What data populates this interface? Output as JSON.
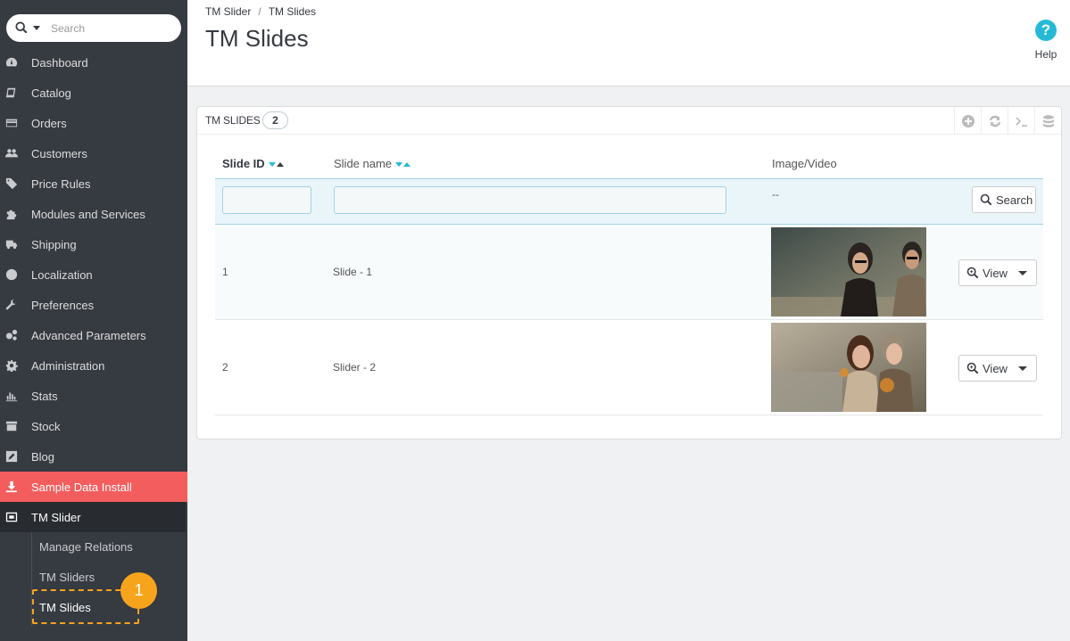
{
  "sidebar": {
    "search_placeholder": "Search",
    "items": [
      {
        "label": "Dashboard",
        "icon": "dashboard-icon"
      },
      {
        "label": "Catalog",
        "icon": "book-icon"
      },
      {
        "label": "Orders",
        "icon": "credit-card-icon"
      },
      {
        "label": "Customers",
        "icon": "users-icon"
      },
      {
        "label": "Price Rules",
        "icon": "tags-icon"
      },
      {
        "label": "Modules and Services",
        "icon": "puzzle-icon"
      },
      {
        "label": "Shipping",
        "icon": "truck-icon"
      },
      {
        "label": "Localization",
        "icon": "globe-icon"
      },
      {
        "label": "Preferences",
        "icon": "wrench-icon"
      },
      {
        "label": "Advanced Parameters",
        "icon": "cogs-icon"
      },
      {
        "label": "Administration",
        "icon": "cog-icon"
      },
      {
        "label": "Stats",
        "icon": "bar-chart-icon"
      },
      {
        "label": "Stock",
        "icon": "archive-icon"
      },
      {
        "label": "Blog",
        "icon": "edit-icon"
      },
      {
        "label": "Sample Data Install",
        "icon": "download-icon"
      },
      {
        "label": "TM Slider",
        "icon": "slider-icon"
      }
    ],
    "submenu": [
      {
        "label": "Manage Relations"
      },
      {
        "label": "TM Sliders"
      },
      {
        "label": "TM Slides"
      }
    ],
    "marker_number": "1"
  },
  "header": {
    "breadcrumb": [
      "TM Slider",
      "TM Slides"
    ],
    "breadcrumb_sep": "/",
    "title": "TM Slides",
    "help_label": "Help",
    "help_glyph": "?"
  },
  "panel": {
    "title": "TM SLIDES",
    "count": "2",
    "toolbar": [
      "add-icon",
      "refresh-icon",
      "sql-icon",
      "database-icon"
    ],
    "columns": {
      "id": "Slide ID",
      "name": "Slide name",
      "image": "Image/Video"
    },
    "filter_placeholder_dash": "--",
    "search_button": "Search",
    "rows": [
      {
        "id": "1",
        "name": "Slide - 1",
        "view": "View"
      },
      {
        "id": "2",
        "name": "Slider - 2",
        "view": "View"
      }
    ]
  },
  "colors": {
    "sidebar_bg": "#363a41",
    "accent": "#25b9d7",
    "sample_data_red": "#f45d5d",
    "marker_orange": "#f7a41d"
  }
}
